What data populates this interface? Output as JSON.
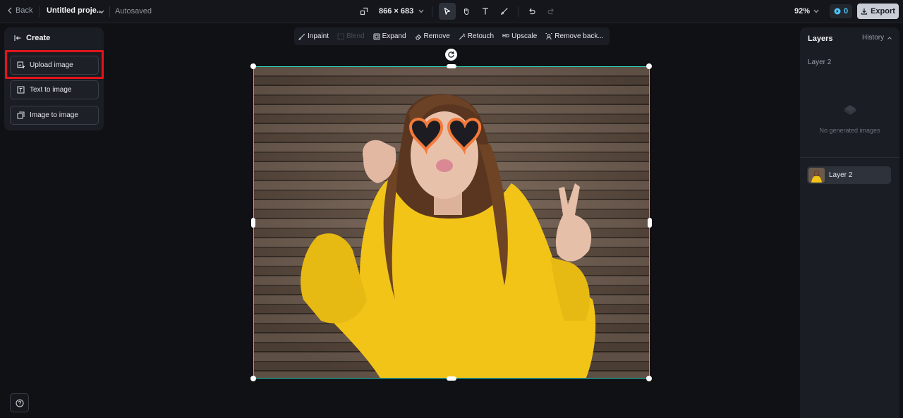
{
  "topbar": {
    "back_label": "Back",
    "project_title": "Untitled proje...",
    "autosave_status": "Autosaved",
    "canvas_size": "866 × 683",
    "zoom": "92%",
    "credits": "0",
    "export_label": "Export",
    "tools": [
      "select-tool",
      "hand-tool",
      "text-tool",
      "brush-tool",
      "undo",
      "redo"
    ]
  },
  "left_panel": {
    "header": "Create",
    "buttons": [
      {
        "label": "Upload image"
      },
      {
        "label": "Text to image"
      },
      {
        "label": "Image to image"
      }
    ]
  },
  "edit_toolbar": {
    "items": [
      {
        "label": "Inpaint",
        "enabled": true
      },
      {
        "label": "Blend",
        "enabled": false
      },
      {
        "label": "Expand",
        "enabled": true
      },
      {
        "label": "Remove",
        "enabled": true
      },
      {
        "label": "Retouch",
        "enabled": true
      },
      {
        "label": "Upscale",
        "enabled": true,
        "prefix": "HD"
      },
      {
        "label": "Remove back...",
        "enabled": true
      }
    ]
  },
  "right_panel": {
    "tab_layers": "Layers",
    "tab_history": "History",
    "layer_group_title": "Layer 2",
    "empty_text": "No generated images",
    "layers": [
      {
        "name": "Layer 2"
      }
    ]
  },
  "colors": {
    "accent_selection": "#2dd4bf",
    "highlight_box": "#e1141b",
    "credits_accent": "#4fc3f7"
  }
}
